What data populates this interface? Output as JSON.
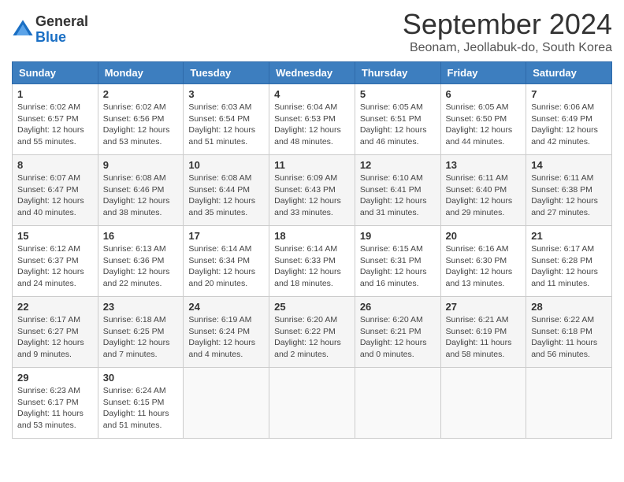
{
  "header": {
    "logo_general": "General",
    "logo_blue": "Blue",
    "title": "September 2024",
    "subtitle": "Beonam, Jeollabuk-do, South Korea"
  },
  "calendar": {
    "days_of_week": [
      "Sunday",
      "Monday",
      "Tuesday",
      "Wednesday",
      "Thursday",
      "Friday",
      "Saturday"
    ],
    "weeks": [
      [
        {
          "day": "1",
          "sunrise": "6:02 AM",
          "sunset": "6:57 PM",
          "daylight": "12 hours and 55 minutes."
        },
        {
          "day": "2",
          "sunrise": "6:02 AM",
          "sunset": "6:56 PM",
          "daylight": "12 hours and 53 minutes."
        },
        {
          "day": "3",
          "sunrise": "6:03 AM",
          "sunset": "6:54 PM",
          "daylight": "12 hours and 51 minutes."
        },
        {
          "day": "4",
          "sunrise": "6:04 AM",
          "sunset": "6:53 PM",
          "daylight": "12 hours and 48 minutes."
        },
        {
          "day": "5",
          "sunrise": "6:05 AM",
          "sunset": "6:51 PM",
          "daylight": "12 hours and 46 minutes."
        },
        {
          "day": "6",
          "sunrise": "6:05 AM",
          "sunset": "6:50 PM",
          "daylight": "12 hours and 44 minutes."
        },
        {
          "day": "7",
          "sunrise": "6:06 AM",
          "sunset": "6:49 PM",
          "daylight": "12 hours and 42 minutes."
        }
      ],
      [
        {
          "day": "8",
          "sunrise": "6:07 AM",
          "sunset": "6:47 PM",
          "daylight": "12 hours and 40 minutes."
        },
        {
          "day": "9",
          "sunrise": "6:08 AM",
          "sunset": "6:46 PM",
          "daylight": "12 hours and 38 minutes."
        },
        {
          "day": "10",
          "sunrise": "6:08 AM",
          "sunset": "6:44 PM",
          "daylight": "12 hours and 35 minutes."
        },
        {
          "day": "11",
          "sunrise": "6:09 AM",
          "sunset": "6:43 PM",
          "daylight": "12 hours and 33 minutes."
        },
        {
          "day": "12",
          "sunrise": "6:10 AM",
          "sunset": "6:41 PM",
          "daylight": "12 hours and 31 minutes."
        },
        {
          "day": "13",
          "sunrise": "6:11 AM",
          "sunset": "6:40 PM",
          "daylight": "12 hours and 29 minutes."
        },
        {
          "day": "14",
          "sunrise": "6:11 AM",
          "sunset": "6:38 PM",
          "daylight": "12 hours and 27 minutes."
        }
      ],
      [
        {
          "day": "15",
          "sunrise": "6:12 AM",
          "sunset": "6:37 PM",
          "daylight": "12 hours and 24 minutes."
        },
        {
          "day": "16",
          "sunrise": "6:13 AM",
          "sunset": "6:36 PM",
          "daylight": "12 hours and 22 minutes."
        },
        {
          "day": "17",
          "sunrise": "6:14 AM",
          "sunset": "6:34 PM",
          "daylight": "12 hours and 20 minutes."
        },
        {
          "day": "18",
          "sunrise": "6:14 AM",
          "sunset": "6:33 PM",
          "daylight": "12 hours and 18 minutes."
        },
        {
          "day": "19",
          "sunrise": "6:15 AM",
          "sunset": "6:31 PM",
          "daylight": "12 hours and 16 minutes."
        },
        {
          "day": "20",
          "sunrise": "6:16 AM",
          "sunset": "6:30 PM",
          "daylight": "12 hours and 13 minutes."
        },
        {
          "day": "21",
          "sunrise": "6:17 AM",
          "sunset": "6:28 PM",
          "daylight": "12 hours and 11 minutes."
        }
      ],
      [
        {
          "day": "22",
          "sunrise": "6:17 AM",
          "sunset": "6:27 PM",
          "daylight": "12 hours and 9 minutes."
        },
        {
          "day": "23",
          "sunrise": "6:18 AM",
          "sunset": "6:25 PM",
          "daylight": "12 hours and 7 minutes."
        },
        {
          "day": "24",
          "sunrise": "6:19 AM",
          "sunset": "6:24 PM",
          "daylight": "12 hours and 4 minutes."
        },
        {
          "day": "25",
          "sunrise": "6:20 AM",
          "sunset": "6:22 PM",
          "daylight": "12 hours and 2 minutes."
        },
        {
          "day": "26",
          "sunrise": "6:20 AM",
          "sunset": "6:21 PM",
          "daylight": "12 hours and 0 minutes."
        },
        {
          "day": "27",
          "sunrise": "6:21 AM",
          "sunset": "6:19 PM",
          "daylight": "11 hours and 58 minutes."
        },
        {
          "day": "28",
          "sunrise": "6:22 AM",
          "sunset": "6:18 PM",
          "daylight": "11 hours and 56 minutes."
        }
      ],
      [
        {
          "day": "29",
          "sunrise": "6:23 AM",
          "sunset": "6:17 PM",
          "daylight": "11 hours and 53 minutes."
        },
        {
          "day": "30",
          "sunrise": "6:24 AM",
          "sunset": "6:15 PM",
          "daylight": "11 hours and 51 minutes."
        },
        null,
        null,
        null,
        null,
        null
      ]
    ]
  }
}
